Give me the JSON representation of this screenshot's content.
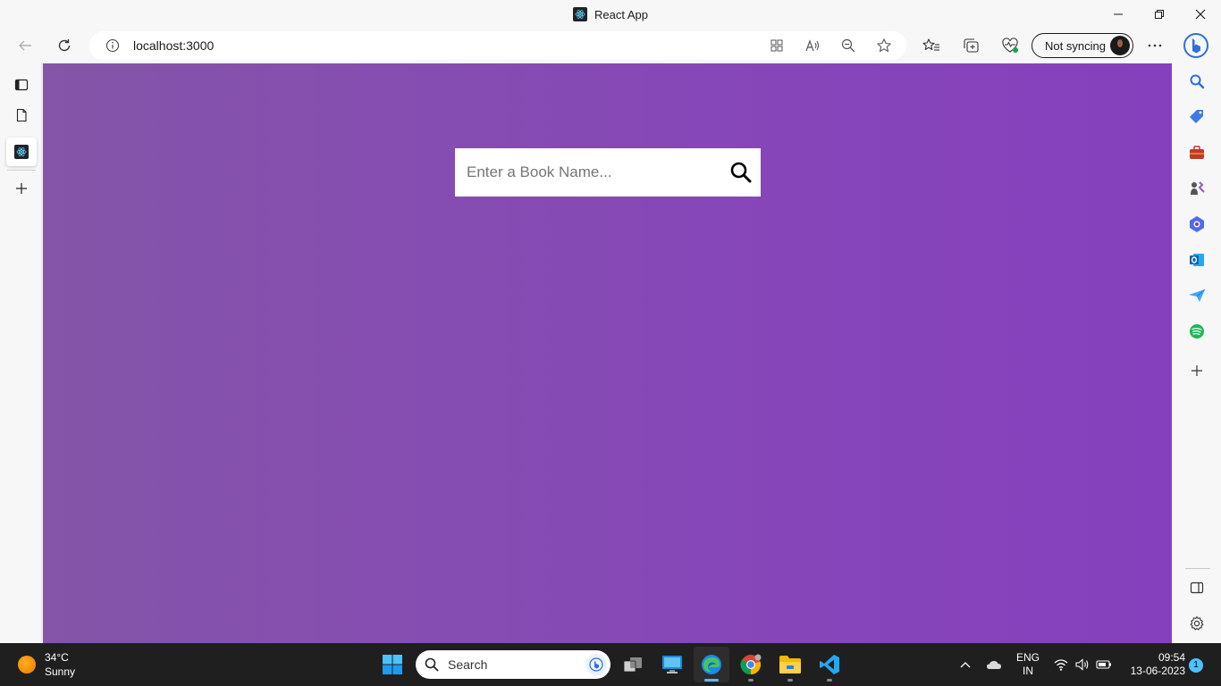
{
  "window": {
    "title": "React App",
    "controls": [
      "minimize",
      "restore",
      "close"
    ]
  },
  "toolbar": {
    "back_icon": "back-arrow-icon",
    "refresh_icon": "refresh-icon",
    "address": {
      "url": "localhost:3000",
      "site_info_icon": "info-icon",
      "icons": [
        "app-available-icon",
        "read-aloud-icon",
        "zoom-out-icon",
        "favorite-star-icon"
      ]
    },
    "right_icons": [
      "favorites-icon",
      "collections-icon",
      "browser-essentials-icon"
    ],
    "sync_label": "Not syncing",
    "more_icon": "more-icon",
    "bing_icon": "bing-icon"
  },
  "left_tabs": {
    "items": [
      "tab-actions-icon",
      "new-tab-page-icon",
      "react-app-tab",
      "new-tab-plus-icon"
    ]
  },
  "right_sidebar": {
    "items": [
      "search-icon",
      "shopping-icon",
      "tools-icon",
      "games-icon",
      "microsoft-365-icon",
      "outlook-icon",
      "drop-icon",
      "spotify-icon",
      "add-icon"
    ],
    "bottom": [
      "hide-sidebar-icon",
      "settings-icon"
    ]
  },
  "page": {
    "search_placeholder": "Enter a Book Name...",
    "search_value": "",
    "colors": {
      "background_start": "#8455a8",
      "background_end": "#8540bd",
      "search_bg": "#ffffff"
    }
  },
  "taskbar": {
    "weather": {
      "temp": "34°C",
      "condition": "Sunny"
    },
    "search_label": "Search",
    "apps": [
      "start",
      "task-view",
      "remote-desktop",
      "edge",
      "chrome",
      "file-explorer",
      "vscode"
    ],
    "active_app": "edge",
    "tray": {
      "lang_line1": "ENG",
      "lang_line2": "IN",
      "time": "09:54",
      "date": "13-06-2023",
      "notifications": "1"
    }
  }
}
